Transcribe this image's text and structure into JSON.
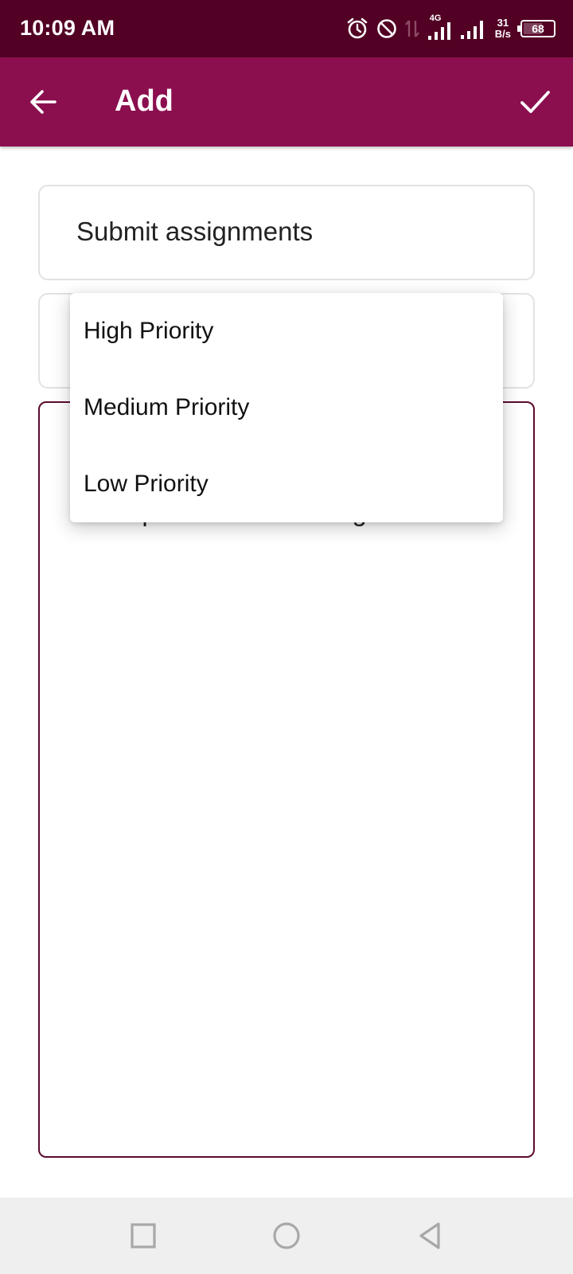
{
  "status_bar": {
    "time": "10:09 AM",
    "network_type": "4G",
    "speed_value": "31",
    "speed_unit": "B/s",
    "battery_level": "68",
    "battery_fraction": 0.68,
    "icons": [
      "alarm-icon",
      "do-not-disturb-icon",
      "data-transfer-icon",
      "signal-4g-icon",
      "signal-icon",
      "battery-icon"
    ]
  },
  "app_bar": {
    "title": "Add",
    "back_icon": "arrow-back-icon",
    "confirm_icon": "check-icon",
    "background_color": "#8b0f4f"
  },
  "form": {
    "title_value": "Submit assignments",
    "description_value": "computer science assignment"
  },
  "priority_menu": {
    "options": [
      "High Priority",
      "Medium Priority",
      "Low Priority"
    ]
  },
  "nav_bar": {
    "icons": [
      "recents-icon",
      "home-icon",
      "back-icon"
    ]
  },
  "colors": {
    "status_bar": "#520024",
    "accent": "#8b0f4f",
    "description_border": "#5a0a2e"
  }
}
